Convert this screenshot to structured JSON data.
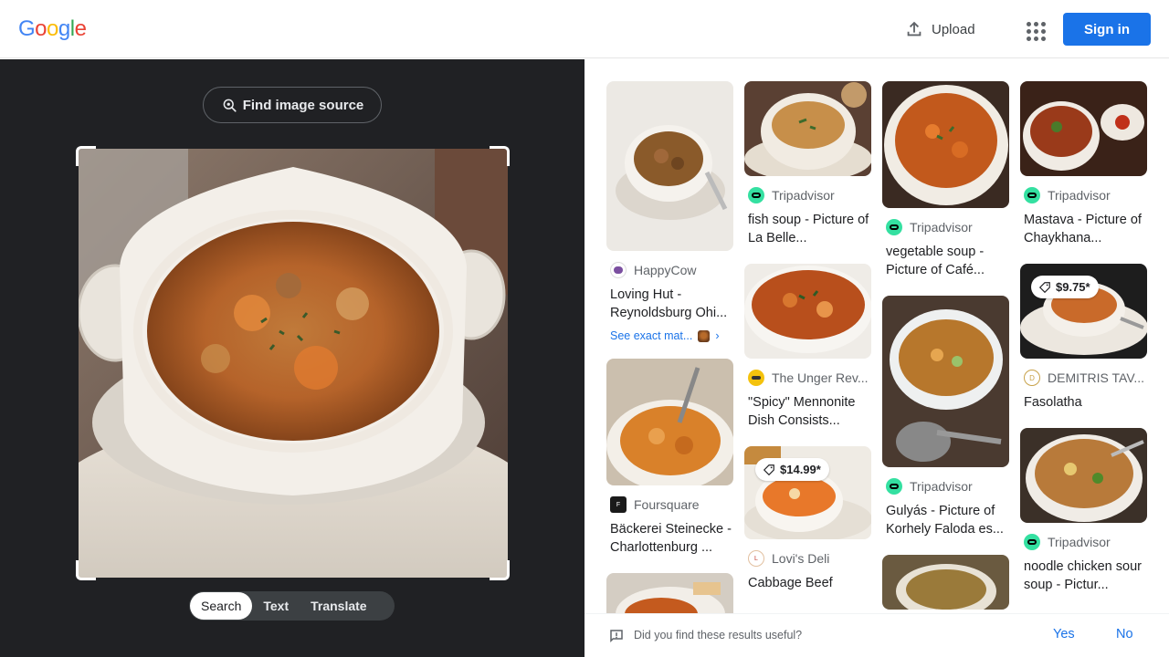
{
  "header": {
    "logo_letters": [
      "G",
      "o",
      "o",
      "g",
      "l",
      "e"
    ],
    "logo_colors": [
      "#4285f4",
      "#ea4335",
      "#fbbc05",
      "#4285f4",
      "#34a853",
      "#ea4335"
    ],
    "upload_label": "Upload",
    "apps_icon": "apps-grid-icon",
    "signin_label": "Sign in"
  },
  "left": {
    "find_source_label": "Find image source",
    "modes": [
      "Search",
      "Text",
      "Translate"
    ],
    "active_mode": "Search"
  },
  "results": {
    "col1": [
      {
        "source": "HappyCow",
        "title": "Loving Hut - Reynoldsburg Ohi...",
        "exact_label": "See exact mat...",
        "fav_color": "#7b4fa0"
      },
      {
        "source": "Foursquare",
        "title": "Bäckerei Steinecke - Charlottenburg ...",
        "fav_color": "#1a1a1a"
      },
      {
        "source": "",
        "title": ""
      }
    ],
    "col2": [
      {
        "source": "Tripadvisor",
        "title": "fish soup - Picture of La Belle...",
        "fav_color": "#34e0a1"
      },
      {
        "source": "The Unger Rev...",
        "title": "\"Spicy\" Mennonite Dish Consists...",
        "fav_color": "#f4c20d"
      },
      {
        "source": "Lovi's Deli",
        "title": "Cabbage Beef",
        "price": "$14.99*",
        "fav_color": "#c0392b"
      }
    ],
    "col3": [
      {
        "source": "Tripadvisor",
        "title": "vegetable soup - Picture of Café...",
        "fav_color": "#34e0a1"
      },
      {
        "source": "Tripadvisor",
        "title": "Gulyás - Picture of Korhely Faloda es...",
        "fav_color": "#34e0a1"
      }
    ],
    "col4": [
      {
        "source": "Tripadvisor",
        "title": "Mastava - Picture of Chaykhana...",
        "fav_color": "#34e0a1"
      },
      {
        "source": "DEMITRIS TAV...",
        "title": "Fasolatha",
        "price": "$9.75*",
        "fav_color": "#c8a24a"
      },
      {
        "source": "Tripadvisor",
        "title": "noodle chicken sour soup - Pictur...",
        "fav_color": "#34e0a1"
      }
    ]
  },
  "feedback": {
    "question": "Did you find these results useful?",
    "yes": "Yes",
    "no": "No"
  }
}
